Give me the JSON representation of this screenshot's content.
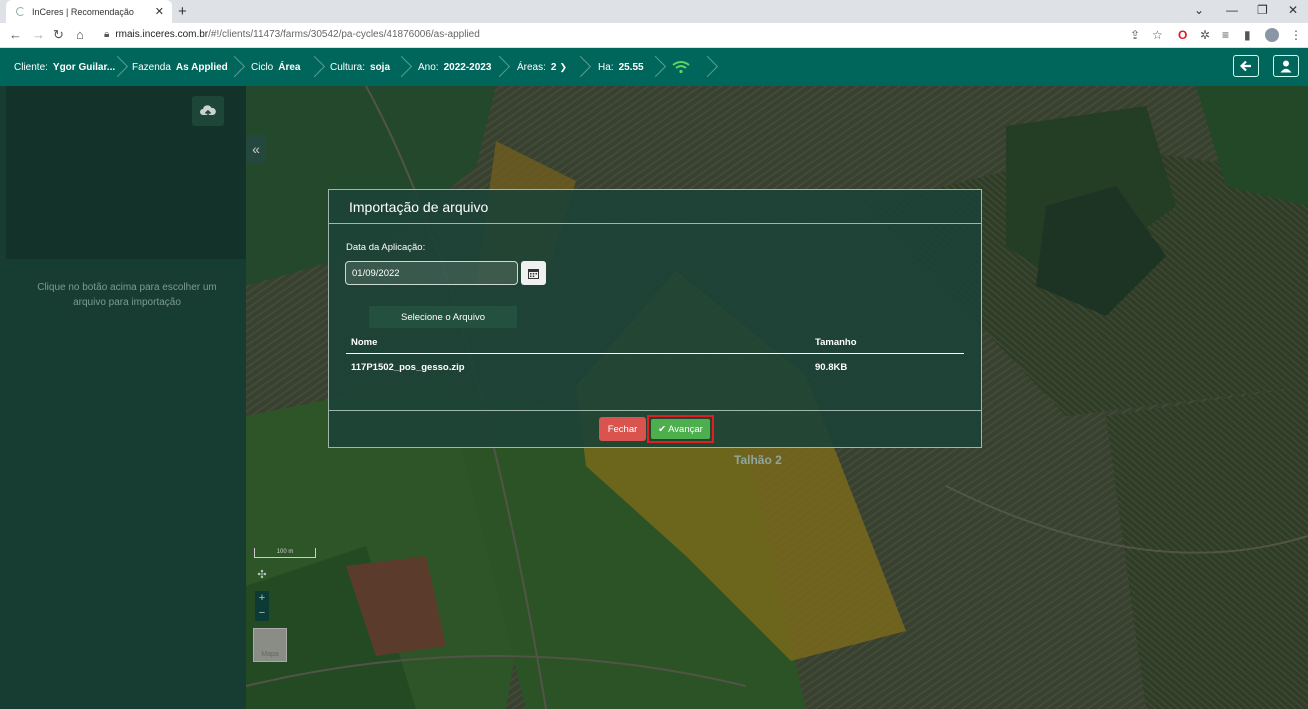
{
  "browser": {
    "tab_title": "InCeres | Recomendação",
    "url_host": "rmais.inceres.com.br",
    "url_path": "/#!/clients/11473/farms/30542/pa-cycles/41876006/as-applied"
  },
  "appbar": {
    "cliente_label": "Cliente:",
    "cliente_value": "Ygor Guilar...",
    "fazenda_label": "Fazenda",
    "fazenda_value": "As Applied",
    "ciclo_label": "Ciclo",
    "ciclo_value": "Área",
    "cultura_label": "Cultura:",
    "cultura_value": "soja",
    "ano_label": "Ano:",
    "ano_value": "2022-2023",
    "areas_label": "Áreas:",
    "areas_value": "2",
    "ha_label": "Ha:",
    "ha_value": "25.55"
  },
  "left_panel": {
    "hint": "Clique no botão acima para escolher um arquivo para importação"
  },
  "map": {
    "field_label": "Talhão 2",
    "scale_label": "100 m",
    "thumb_label": "Mapa"
  },
  "modal": {
    "title": "Importação de arquivo",
    "date_label": "Data da Aplicação:",
    "date_value": "01/09/2022",
    "select_file_label": "Selecione o Arquivo",
    "col_name": "Nome",
    "col_size": "Tamanho",
    "files": [
      {
        "name": "117P1502_pos_gesso.zip",
        "size": "90.8KB"
      }
    ],
    "close_label": "Fechar",
    "next_label": "Avançar"
  },
  "colors": {
    "appbar": "#00665c",
    "close_button": "#d9534f",
    "next_button": "#4cae4c",
    "highlight": "#e0201e"
  }
}
